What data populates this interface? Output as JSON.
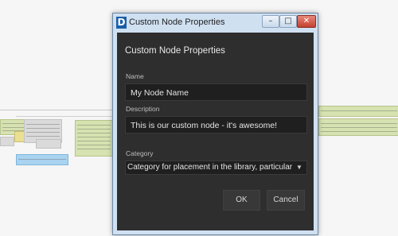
{
  "window": {
    "title": "Custom Node Properties",
    "app_icon_letter": "D",
    "controls": {
      "minimize": "–",
      "maximize": "□",
      "close": "✕"
    }
  },
  "dialog": {
    "heading": "Custom Node Properties",
    "name_label": "Name",
    "name_value": "My Node Name",
    "description_label": "Description",
    "description_value": "This is our custom node - it's awesome!",
    "category_label": "Category",
    "category_value": "Category for placement in the library, particularly",
    "ok_label": "OK",
    "cancel_label": "Cancel"
  },
  "icons": {
    "dropdown": "chevron-down-icon"
  },
  "colors": {
    "dialog_bg": "#2e2e2e",
    "titlebar_bg": "#cfe0f1",
    "close_button": "#c4402f"
  }
}
